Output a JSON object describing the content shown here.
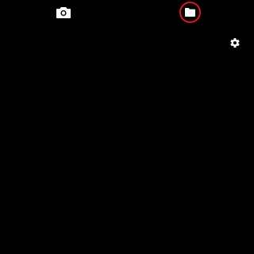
{
  "toolbar": {
    "camera": {
      "icon": "camera-icon"
    },
    "folder": {
      "icon": "folder-icon",
      "highlighted": true,
      "highlight_color": "#d81b1b"
    },
    "settings": {
      "icon": "gear-icon"
    }
  },
  "colors": {
    "background": "#000000",
    "icon": "#ffffff",
    "highlight": "#d81b1b"
  }
}
